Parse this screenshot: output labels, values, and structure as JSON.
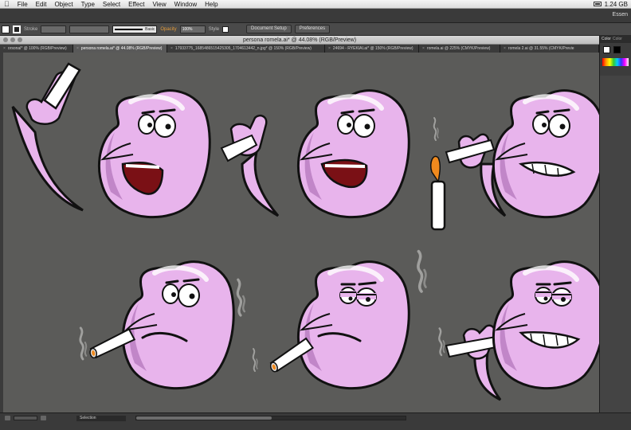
{
  "menubar": {
    "items": [
      "File",
      "Edit",
      "Object",
      "Type",
      "Select",
      "Effect",
      "View",
      "Window",
      "Help"
    ],
    "status_text": "1.24 GB"
  },
  "appbar": {
    "workspace": "Essen"
  },
  "controlbar": {
    "stroke_label": "Stroke",
    "brush_label": "Basic",
    "opacity_label": "Opacity",
    "opacity_value": "100%",
    "style_label": "Style",
    "document_setup_label": "Document Setup",
    "preferences_label": "Preferences"
  },
  "document": {
    "title": "persona romela.ai* @ 44.08% (RGB/Preview)"
  },
  "tabs": [
    {
      "label": "orsonal* @ 100% (RGB/Preview)",
      "active": false
    },
    {
      "label": "persona romela.ai* @ 44.08% (RGB/Preview)",
      "active": true
    },
    {
      "label": "17933775_1685486515425305_1704613442_n.jpg* @ 150% (RGB/Preview)",
      "active": false
    },
    {
      "label": "24694 - RYEKIAI.ai* @ 150% (RGB/Preview)",
      "active": false
    },
    {
      "label": "romela.ai @ 225% (CMYK/Preview)",
      "active": false
    },
    {
      "label": "romela 2.ai @ 31.55% (CMYK/Previe",
      "active": false
    }
  ],
  "panel": {
    "tabs": [
      "Color",
      "Color"
    ],
    "colors": {
      "fill": "#ffffff",
      "stroke": "#000000"
    }
  },
  "status": {
    "mode": "Selection"
  },
  "colors": {
    "canvas": "#5b5b59",
    "character_fill": "#e8b4ec",
    "character_shadow": "#c186c8",
    "outline": "#111111",
    "mouth": "#7a1015",
    "flame": "#f08a1e",
    "smoke": "#a0a09e",
    "accent_orange": "#e49c3a"
  },
  "icons": [
    "apple-icon",
    "battery-icon",
    "fill-swatch-icon",
    "stroke-swatch-icon",
    "fill-stroke-swap-icon",
    "close-icon",
    "prev-artboard-icon",
    "next-artboard-icon"
  ]
}
